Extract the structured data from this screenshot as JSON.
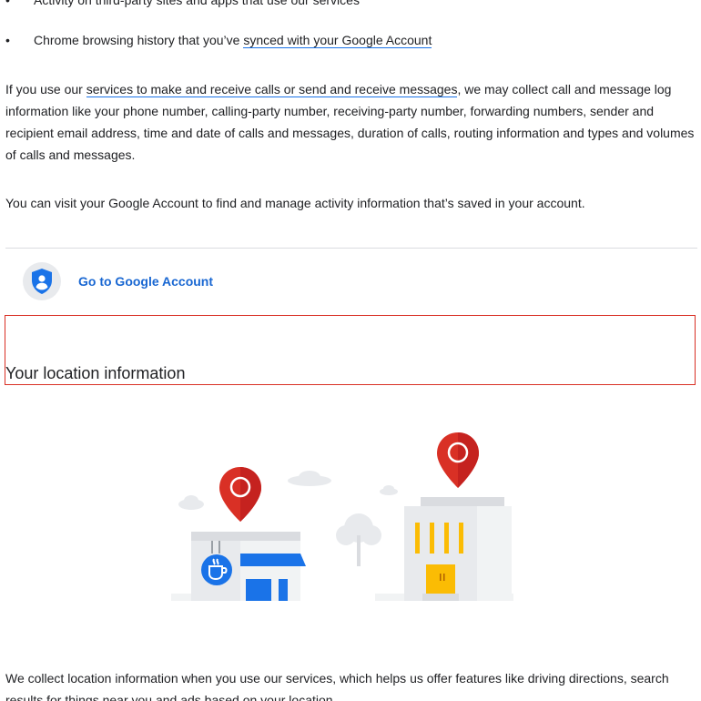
{
  "bullets": [
    {
      "text": "Activity on third-party sites and apps that use our services",
      "link": ""
    },
    {
      "text": "Chrome browsing history that you’ve ",
      "link": "synced with your Google Account"
    }
  ],
  "calls_paragraph": {
    "prefix": "If you use our ",
    "link": "services to make and receive calls or send and receive messages",
    "suffix": ", we may collect call and message log information like your phone number, calling-party number, receiving-party number, forwarding numbers, sender and recipient email address, time and date of calls and messages, duration of calls, routing information and types and volumes of calls and messages."
  },
  "account_paragraph": "You can visit your Google Account to find and manage activity information that’s saved in your account.",
  "account_link": {
    "label": "Go to Google Account",
    "icon": "account-shield-icon"
  },
  "section": {
    "title": "Your location information"
  },
  "location_paragraph": "We collect location information when you use our services, which helps us offer features like driving directions, search results for things near you and ads based on your location.",
  "colors": {
    "link_blue": "#1967d2",
    "pin_red": "#d93025",
    "building_gray": "#e8eaed",
    "accent_yellow": "#fbbc04",
    "highlight_border": "#d93025"
  }
}
